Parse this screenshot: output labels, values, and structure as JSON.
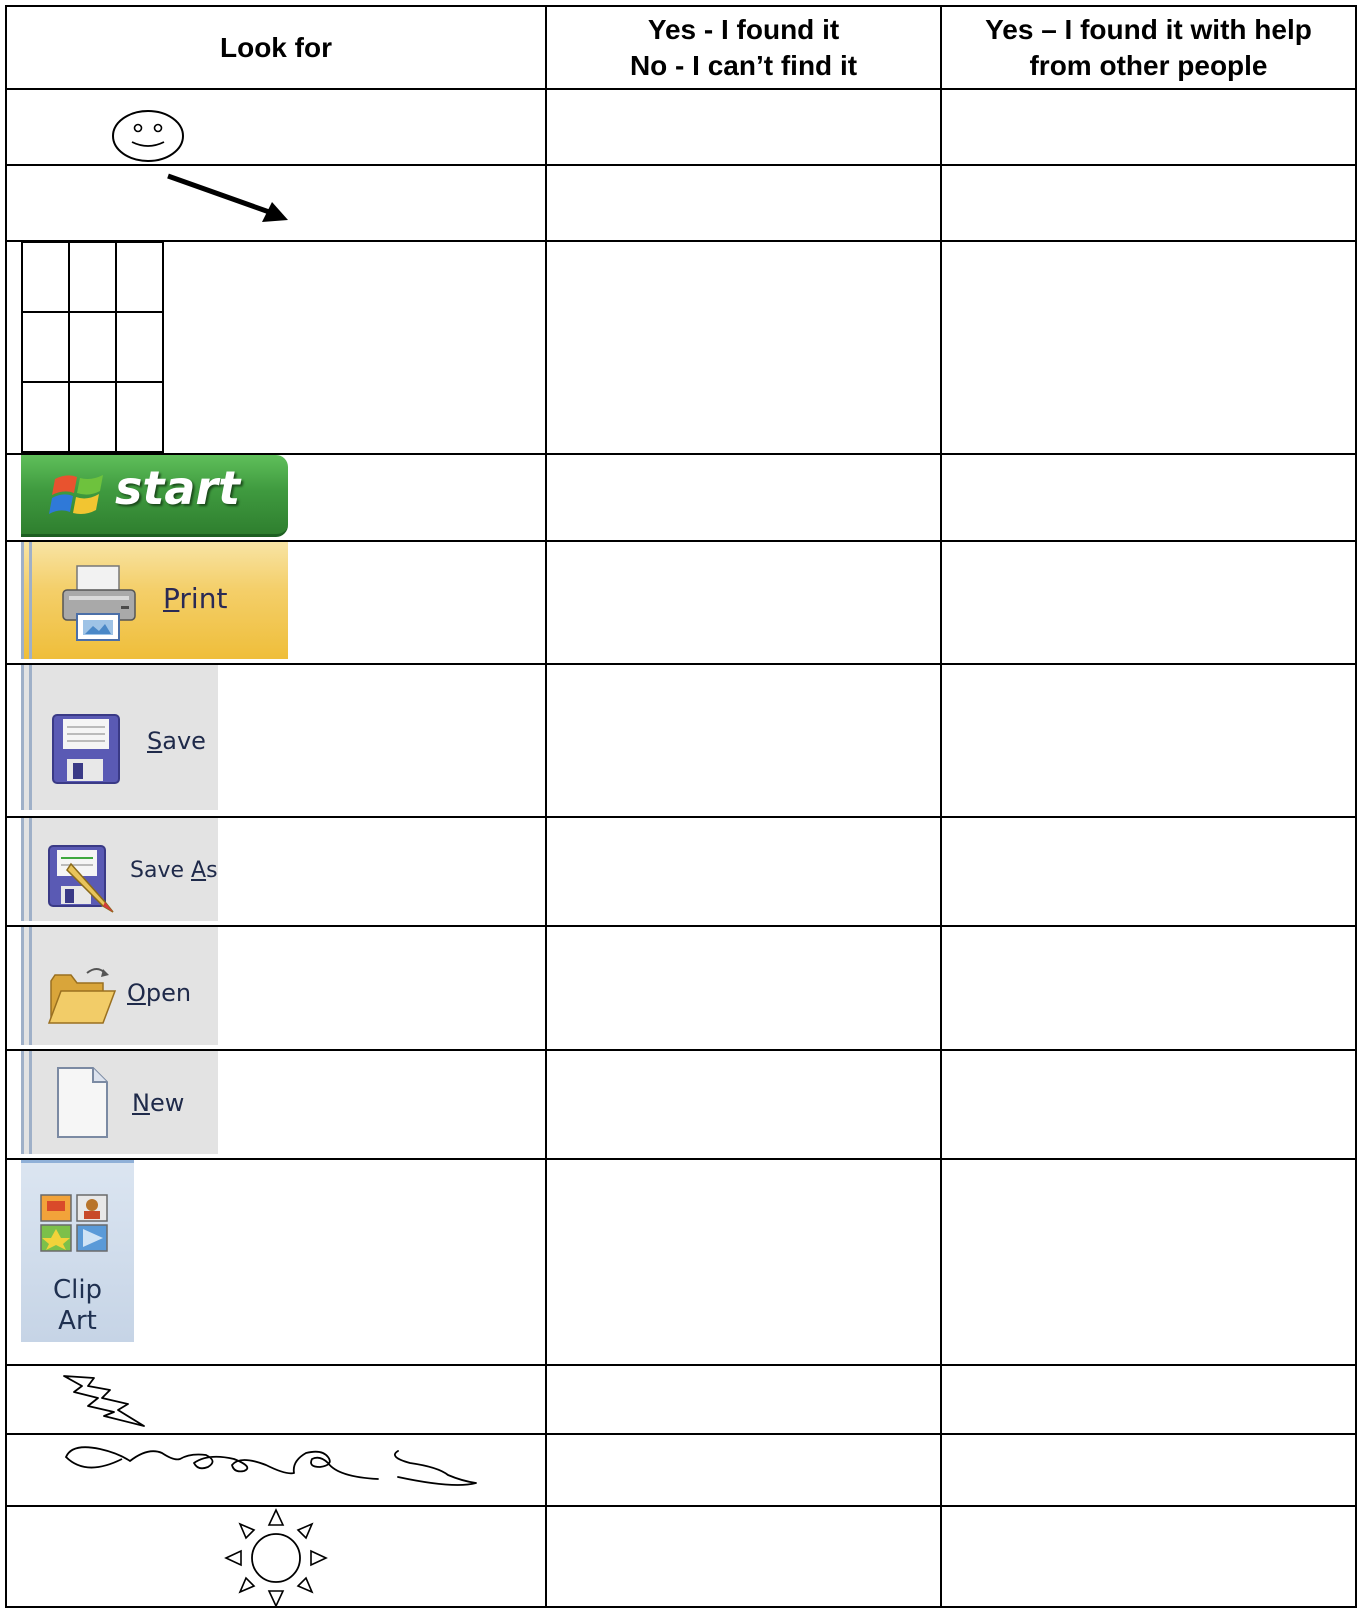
{
  "header": {
    "col1": "Look for",
    "col2_line1": "Yes - I found it",
    "col2_line2": "No - I can’t find it",
    "col3_line1": "Yes – I found it with help",
    "col3_line2": "from other people"
  },
  "rows": {
    "smiley": {
      "icon": "smiley-face-icon"
    },
    "arrow": {
      "icon": "arrow-icon"
    },
    "table": {
      "icon": "table-grid-icon"
    },
    "start": {
      "icon": "windows-logo-icon",
      "label": "start"
    },
    "print": {
      "icon": "printer-icon",
      "hotkey": "P",
      "rest": "rint"
    },
    "save": {
      "icon": "floppy-disk-icon",
      "hotkey": "S",
      "rest": "ave"
    },
    "save_as": {
      "icon": "floppy-pencil-icon",
      "prefix": "Save ",
      "hotkey": "A",
      "rest": "s"
    },
    "open": {
      "icon": "folder-icon",
      "hotkey": "O",
      "rest": "pen"
    },
    "new": {
      "icon": "blank-page-icon",
      "hotkey": "N",
      "rest": "ew"
    },
    "clip_art": {
      "icon": "clip-art-icon",
      "line1": "Clip",
      "line2": "Art"
    },
    "lightning": {
      "icon": "lightning-bolt-icon"
    },
    "scribble": {
      "icon": "freeform-scribble-icon"
    },
    "sun": {
      "icon": "sun-icon"
    }
  },
  "colors": {
    "start_green": "#3f9a3f",
    "print_gold": "#f0c24a",
    "toolbar_gray": "#e3e3e3",
    "floppy_purple": "#5a5ab4",
    "clip_art_blue": "#c6d4e6"
  }
}
